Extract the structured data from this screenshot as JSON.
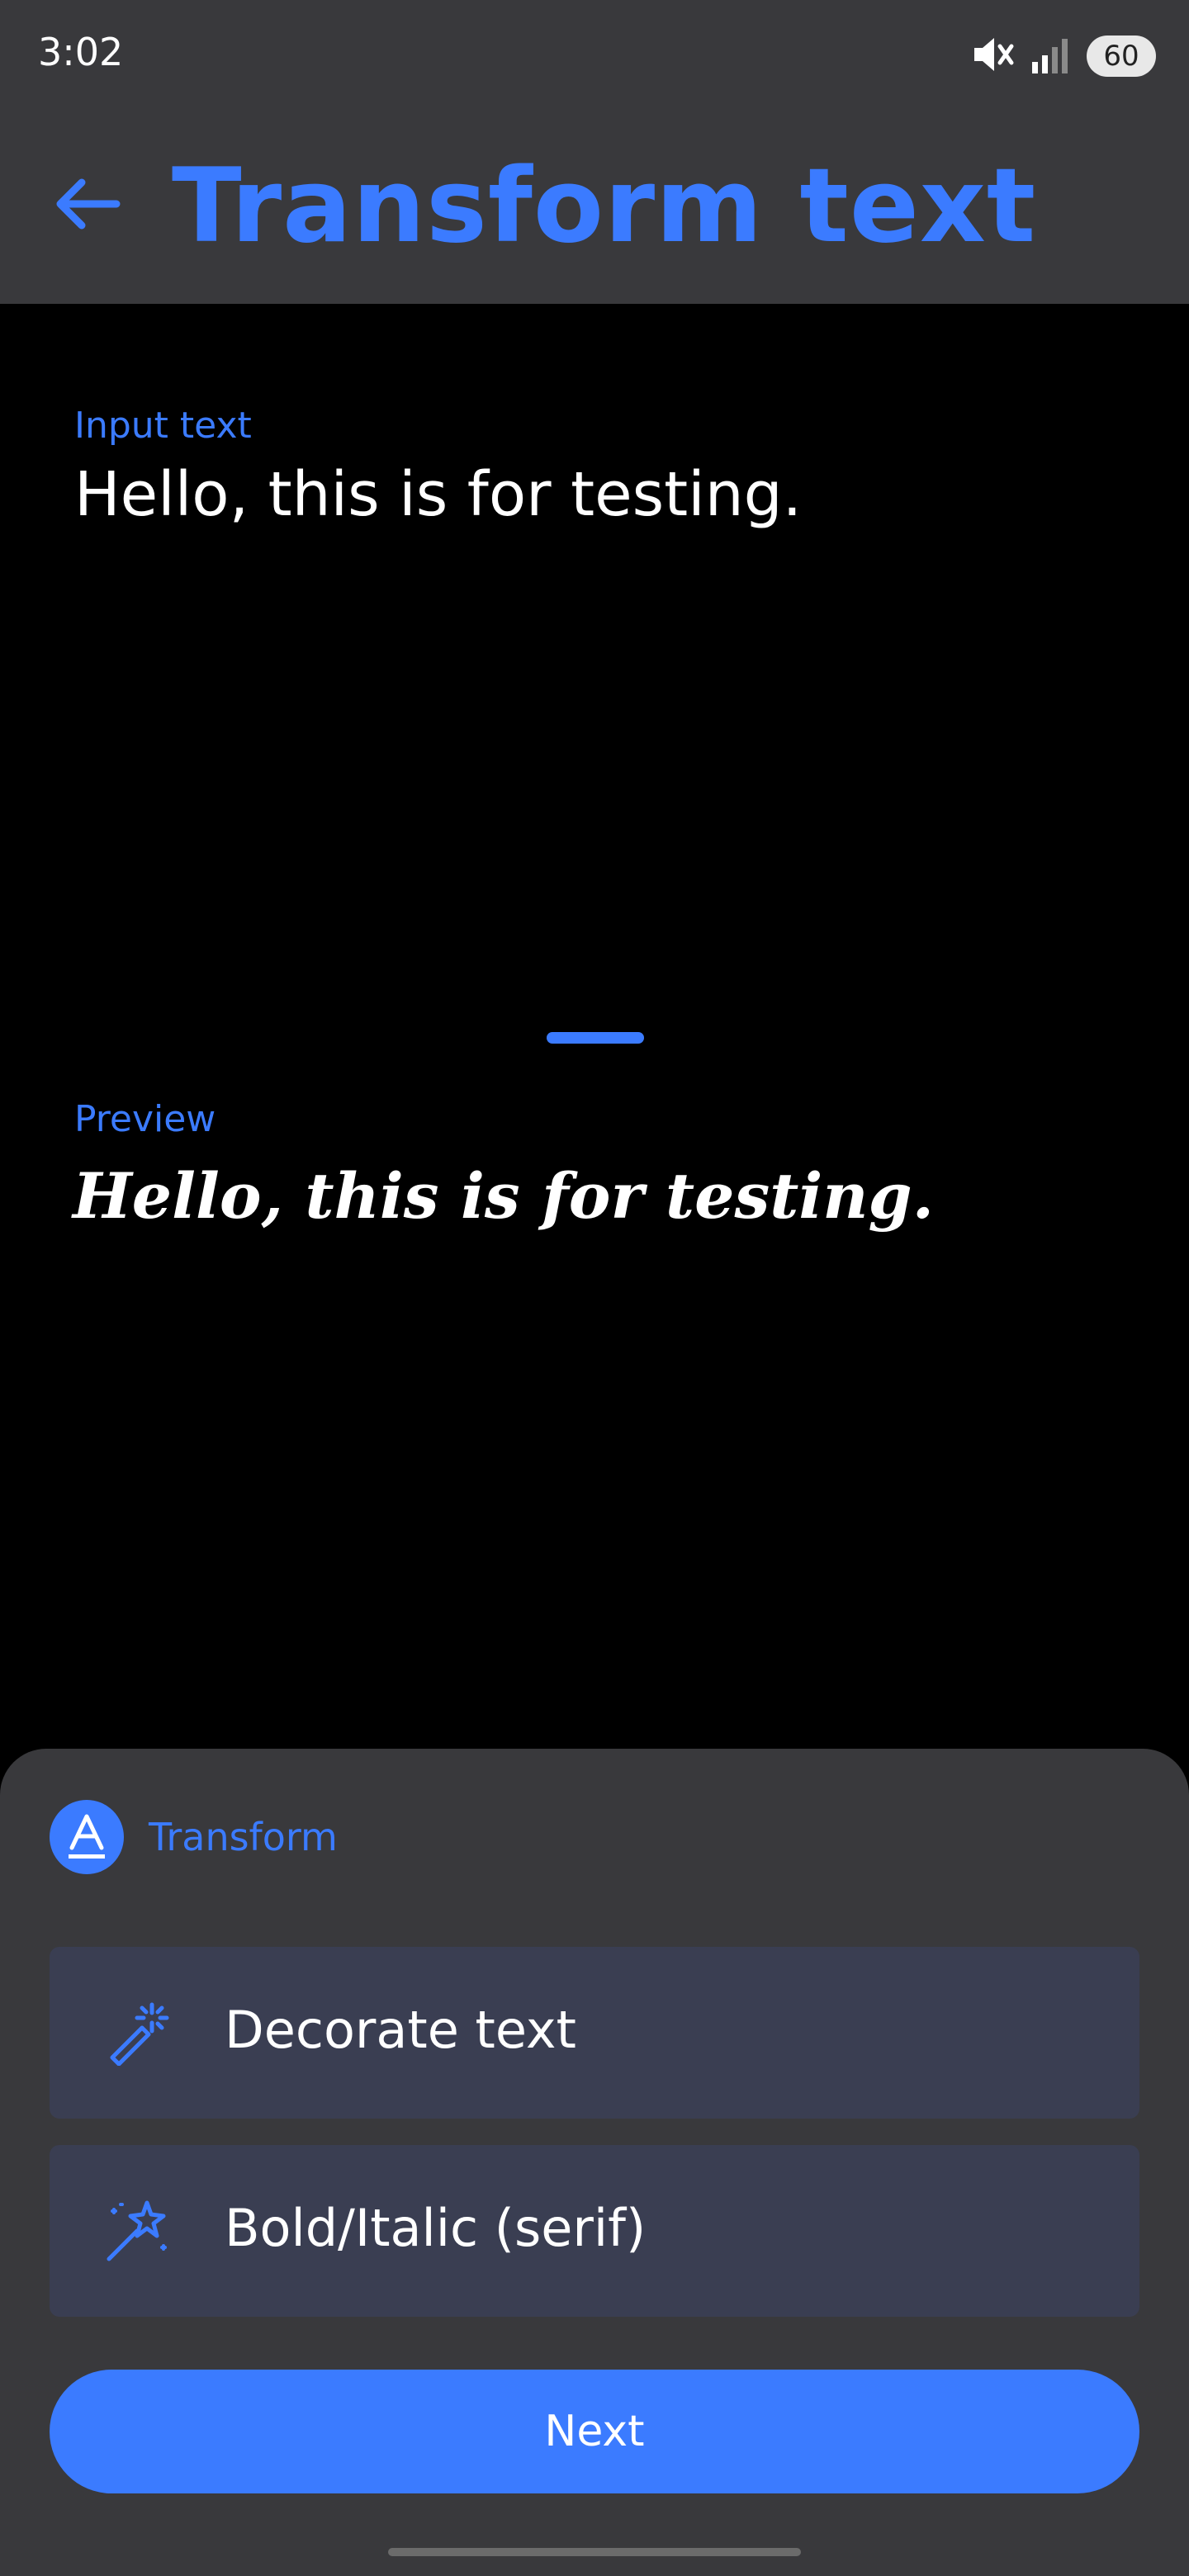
{
  "status_bar": {
    "time": "3:02",
    "battery": "60",
    "icons": [
      "mute-icon",
      "signal-icon",
      "battery-icon"
    ]
  },
  "app_bar": {
    "title": "Transform text",
    "back_icon": "arrow-left-icon"
  },
  "input": {
    "label": "Input text",
    "value": "Hello, this is for testing."
  },
  "preview": {
    "label": "Preview",
    "value": "Hello, this is for testing."
  },
  "sheet": {
    "header_label": "Transform",
    "header_icon": "text-format-icon",
    "options": [
      {
        "label": "Decorate text",
        "icon": "magic-wand-icon"
      },
      {
        "label": "Bold/Italic (serif)",
        "icon": "sparkle-wand-icon"
      }
    ],
    "next_label": "Next"
  },
  "colors": {
    "accent": "#3b7bff",
    "surface": "#39393c",
    "option_bg": "#3a3e52",
    "background": "#000000"
  }
}
